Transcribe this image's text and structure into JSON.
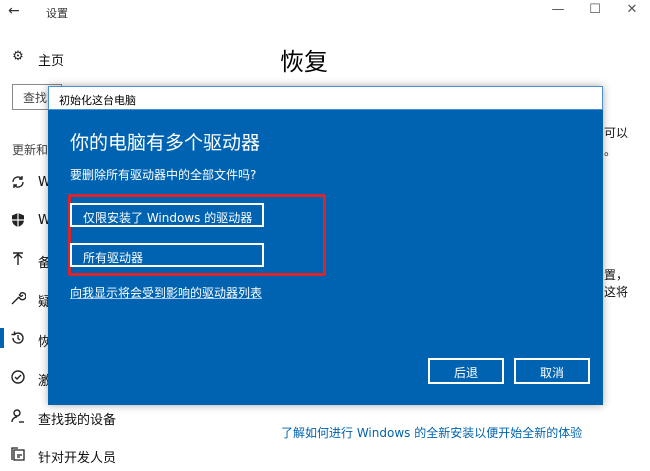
{
  "window": {
    "back_glyph": "←",
    "app_title": "设置",
    "minimize_glyph": "—",
    "maximize_glyph": "☐",
    "close_glyph": "✕"
  },
  "sidebar": {
    "home_label": "主页",
    "search_placeholder": "查找",
    "section_label": "更新和",
    "items": [
      {
        "icon": "sync-icon",
        "label": "W"
      },
      {
        "icon": "shield-icon",
        "label": "W"
      },
      {
        "icon": "upload-icon",
        "label": "备"
      },
      {
        "icon": "wrench-icon",
        "label": "疑"
      },
      {
        "icon": "history-icon",
        "label": "恢"
      },
      {
        "icon": "check-circle-icon",
        "label": "激"
      },
      {
        "icon": "person-search-icon",
        "label": "查找我的设备"
      },
      {
        "icon": "developer-icon",
        "label": "针对开发人员"
      }
    ]
  },
  "main": {
    "page_title": "恢复",
    "clip_text_1": "可以",
    "clip_text_2": "。",
    "clip_text_3": "置，",
    "clip_text_4": "这将",
    "bottom_link": "了解如何进行 Windows 的全新安装以便开始全新的体验"
  },
  "dialog": {
    "title": "初始化这台电脑",
    "heading": "你的电脑有多个驱动器",
    "question": "要删除所有驱动器中的全部文件吗?",
    "option_windows_drive": "仅限安装了 Windows 的驱动器",
    "option_all_drives": "所有驱动器",
    "drive_list_link": "向我显示将会受到影响的驱动器列表",
    "back_button": "后退",
    "cancel_button": "取消"
  },
  "colors": {
    "dialog_blue": "#0063b1",
    "highlight_red": "#d9262c",
    "link_blue": "#0063b1"
  }
}
